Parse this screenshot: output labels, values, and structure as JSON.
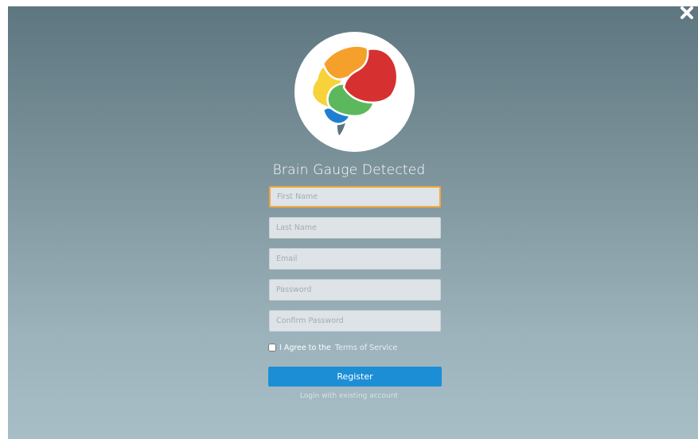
{
  "dialog": {
    "title": "Brain Gauge Detected",
    "close_icon": "close-x-icon",
    "logo_icon": "brain-logo-icon"
  },
  "form": {
    "first_name": {
      "placeholder": "First Name",
      "value": ""
    },
    "last_name": {
      "placeholder": "Last Name",
      "value": ""
    },
    "email": {
      "placeholder": "Email",
      "value": ""
    },
    "password": {
      "placeholder": "Password",
      "value": ""
    },
    "confirm_password": {
      "placeholder": "Confirm Password",
      "value": ""
    },
    "agree_text": "I Agree to the",
    "terms_link": "Terms of Service",
    "agree_checked": false,
    "register_label": "Register",
    "login_link": "Login with existing account"
  },
  "colors": {
    "accent_button": "#1c8ed6",
    "focus_border": "#f0a83c",
    "brain_red": "#d63030",
    "brain_orange": "#f5a02a",
    "brain_yellow": "#f7d23a",
    "brain_green": "#5cb85c",
    "brain_blue": "#1f7fcf",
    "brain_stem": "#5d7580"
  }
}
